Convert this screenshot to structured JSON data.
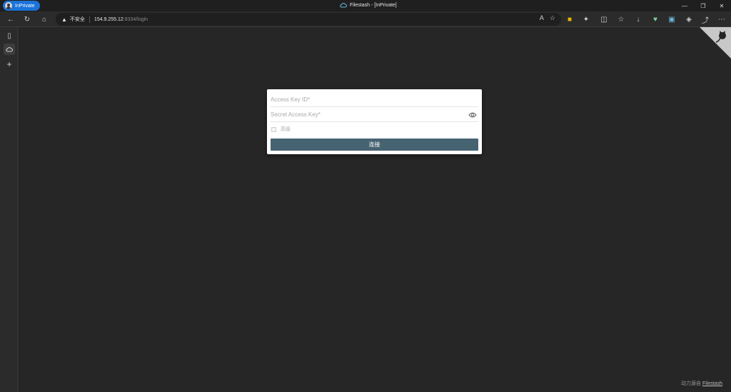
{
  "browser": {
    "profile_label": "InPrivate",
    "window_title": "Filestash - [InPrivate]",
    "security_label": "不安全",
    "url_host": "154.9.255.12",
    "url_path": ":8334/login"
  },
  "login": {
    "access_key_placeholder": "Access Key ID*",
    "secret_key_placeholder": "Secret Access Key*",
    "advanced_label": "高级",
    "submit_label": "连接"
  },
  "footer": {
    "powered_by": "动力源自",
    "brand_link": "Filestash"
  }
}
